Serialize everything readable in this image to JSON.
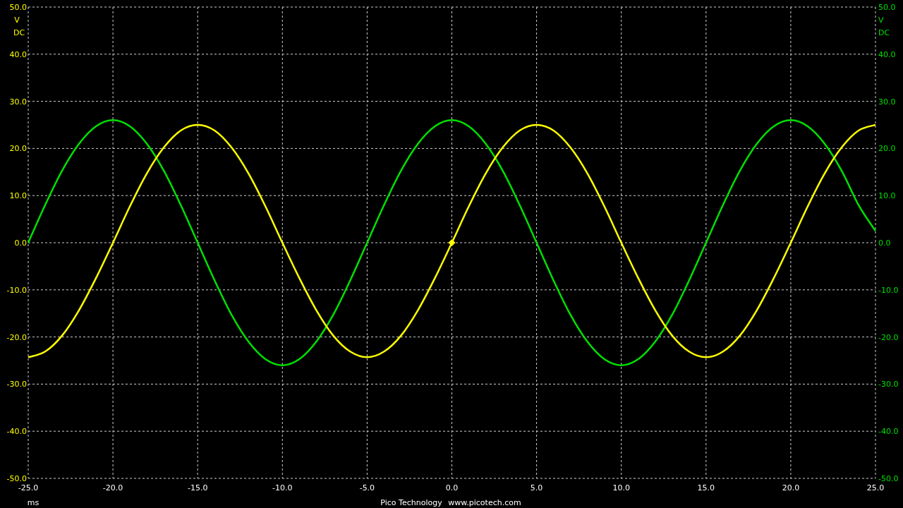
{
  "scope": {
    "chart_data": {
      "type": "line",
      "xlabel": "ms",
      "grid": true,
      "x": [
        -25,
        -24,
        -23,
        -22,
        -21,
        -20,
        -19,
        -18,
        -17,
        -16,
        -15,
        -14,
        -13,
        -12,
        -11,
        -10,
        -9,
        -8,
        -7,
        -6,
        -5,
        -4,
        -3,
        -2,
        -1,
        0,
        1,
        2,
        3,
        4,
        5,
        6,
        7,
        8,
        9,
        10,
        11,
        12,
        13,
        14,
        15,
        16,
        17,
        18,
        19,
        20,
        21,
        22,
        23,
        24,
        25
      ],
      "series": [
        {
          "color": "#00e000",
          "values": [
            0,
            8.0,
            15.3,
            21.0,
            24.7,
            26,
            24.7,
            21.0,
            15.3,
            8.0,
            0,
            -8.0,
            -15.3,
            -21.0,
            -24.7,
            -26,
            -24.7,
            -21.0,
            -15.3,
            -8.0,
            0,
            8.0,
            15.3,
            21.0,
            24.7,
            26,
            24.7,
            21.0,
            15.3,
            8.0,
            0,
            -8.0,
            -15.3,
            -21.0,
            -24.7,
            -26,
            -24.7,
            -21.0,
            -15.3,
            -8.0,
            0,
            8.0,
            15.3,
            21.0,
            24.7,
            26,
            24.7,
            21.0,
            15.3,
            8.0,
            2.5
          ]
        },
        {
          "color": "#ffff00",
          "values": [
            -24.3,
            -23.1,
            -19.7,
            -14.3,
            -7.5,
            0,
            7.7,
            14.7,
            20.2,
            23.8,
            25,
            23.8,
            20.2,
            14.7,
            7.7,
            0,
            -7.5,
            -14.3,
            -19.7,
            -23.1,
            -24.3,
            -23.1,
            -19.7,
            -14.3,
            -7.5,
            0,
            7.7,
            14.7,
            20.2,
            23.8,
            25,
            23.8,
            20.2,
            14.7,
            7.7,
            0,
            -7.5,
            -14.3,
            -19.7,
            -23.1,
            -24.3,
            -23.1,
            -19.7,
            -14.3,
            -7.5,
            0,
            7.7,
            14.7,
            20.2,
            23.8,
            25
          ]
        }
      ],
      "xlim": [
        -25,
        25
      ],
      "ylim": [
        -50,
        50
      ],
      "xticks": [
        {
          "value": -25,
          "label": "-25.0"
        },
        {
          "value": -20,
          "label": "-20.0"
        },
        {
          "value": -15,
          "label": "-15.0"
        },
        {
          "value": -10,
          "label": "-10.0"
        },
        {
          "value": -5,
          "label": "-5.0"
        },
        {
          "value": 0,
          "label": "0.0"
        },
        {
          "value": 5,
          "label": "5.0"
        },
        {
          "value": 10,
          "label": "10.0"
        },
        {
          "value": 15,
          "label": "15.0"
        },
        {
          "value": 20,
          "label": "20.0"
        },
        {
          "value": 25,
          "label": "25.0"
        }
      ],
      "yticks": [
        {
          "value": 50,
          "label": "50.0"
        },
        {
          "value": 40,
          "label": "40.0"
        },
        {
          "value": 30,
          "label": "30.0"
        },
        {
          "value": 20,
          "label": "20.0"
        },
        {
          "value": 10,
          "label": "10.0"
        },
        {
          "value": 0,
          "label": "0.0"
        },
        {
          "value": -10,
          "label": "-10.0"
        },
        {
          "value": -20,
          "label": "-20.0"
        },
        {
          "value": -30,
          "label": "-30.0"
        },
        {
          "value": -40,
          "label": "-40.0"
        },
        {
          "value": -50,
          "label": "-50.0"
        }
      ]
    },
    "trigger_marker": true,
    "left_axis": {
      "unit": "V",
      "coupling": "DC",
      "color": "#ffff00"
    },
    "right_axis": {
      "unit": "V",
      "coupling": "DC",
      "color": "#00e000",
      "ticks": [
        "50.0",
        "40.0",
        "30.0",
        "20.0",
        "10.0",
        "0.0",
        "-10.0",
        "-20.0",
        "-30.0",
        "-40.0",
        "-50.0"
      ]
    },
    "footer": {
      "company": "Pico Technology",
      "website": "www.picotech.com"
    }
  }
}
